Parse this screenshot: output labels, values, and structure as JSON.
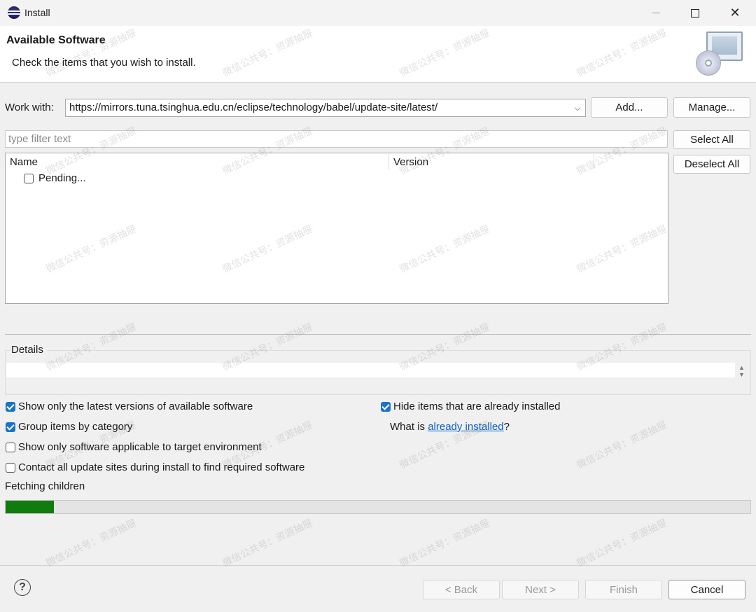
{
  "window": {
    "title": "Install"
  },
  "header": {
    "title": "Available Software",
    "subtitle": "Check the items that you wish to install."
  },
  "work_with": {
    "label": "Work with:",
    "value": "https://mirrors.tuna.tsinghua.edu.cn/eclipse/technology/babel/update-site/latest/",
    "add_label": "Add...",
    "manage_label": "Manage..."
  },
  "filter": {
    "placeholder": "type filter text"
  },
  "selection": {
    "select_all_label": "Select All",
    "deselect_all_label": "Deselect All"
  },
  "table": {
    "columns": [
      "Name",
      "Version"
    ],
    "rows": [
      {
        "name": "Pending...",
        "checked": false
      }
    ]
  },
  "details": {
    "label": "Details"
  },
  "options": {
    "latest_versions": {
      "label": "Show only the latest versions of available software",
      "checked": true
    },
    "group_by_category": {
      "label": "Group items by category",
      "checked": true
    },
    "target_env": {
      "label": "Show only software applicable to target environment",
      "checked": false
    },
    "contact_sites": {
      "label": "Contact all update sites during install to find required software",
      "checked": false
    },
    "hide_installed": {
      "label": "Hide items that are already installed",
      "checked": true
    },
    "what_is_prefix": "What is ",
    "what_is_link": "already installed",
    "what_is_suffix": "?"
  },
  "status": {
    "text": "Fetching children",
    "progress_fraction": 0.065
  },
  "footer": {
    "back_label": "< Back",
    "next_label": "Next >",
    "finish_label": "Finish",
    "cancel_label": "Cancel"
  },
  "watermark": {
    "text": "微信公共号：资源抽屉"
  },
  "colors": {
    "accent": "#1a73c9",
    "progress": "#107c10",
    "link": "#0b62c4"
  }
}
